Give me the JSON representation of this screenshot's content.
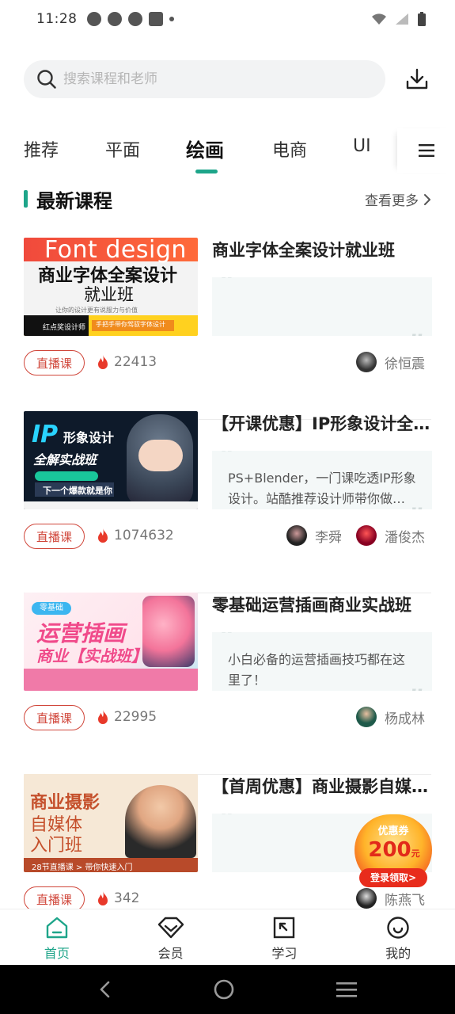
{
  "status_bar": {
    "time": "11:28"
  },
  "search": {
    "placeholder": "搜索课程和老师"
  },
  "tabs": [
    {
      "label": "推荐",
      "active": false
    },
    {
      "label": "平面",
      "active": false
    },
    {
      "label": "绘画",
      "active": true
    },
    {
      "label": "电商",
      "active": false
    },
    {
      "label": "UI",
      "active": false
    }
  ],
  "section": {
    "title": "最新课程",
    "more_label": "查看更多"
  },
  "courses": [
    {
      "title": "商业字体全案设计就业班",
      "description": "",
      "badge": "直播课",
      "views": "22413",
      "teachers": [
        "徐恒震"
      ],
      "thumb": {
        "line1": "Font design",
        "line2": "商业字体全案设计",
        "line3": "就业班",
        "line4": "让你的设计更有说服力与价值",
        "line5": "红点奖设计师",
        "line6": "手把手带你驾驭字体设计"
      }
    },
    {
      "title": "【开课优惠】IP形象设计全解实战班",
      "description": "PS+Blender，一门课吃透IP形象设计。站酷推荐设计师带你做出爆款形象",
      "badge": "直播课",
      "views": "1074632",
      "teachers": [
        "李舜",
        "潘俊杰"
      ],
      "thumb": {
        "line1": "IP",
        "line2": "形象设计",
        "line3": "全解实战班",
        "line4": "下一个爆款就是你"
      }
    },
    {
      "title": "零基础运营插画商业实战班",
      "description": "小白必备的运营插画技巧都在这里了！",
      "badge": "直播课",
      "views": "22995",
      "teachers": [
        "杨成林"
      ],
      "thumb": {
        "line1": "零基础",
        "line2": "运营插画",
        "line3": "商业【实战班】"
      }
    },
    {
      "title": "【首周优惠】商业摄影自媒体入门班",
      "description": "",
      "badge": "直播课",
      "views": "342",
      "teachers": [
        "陈燕飞"
      ],
      "thumb": {
        "line1": "商业摄影",
        "line2": "自媒体",
        "line3": "入门班",
        "line4": "28节直播课 > 带你快速入门"
      }
    }
  ],
  "coupon": {
    "title": "优惠券",
    "amount": "200",
    "unit": "元",
    "action": "登录领取>"
  },
  "bottom_nav": [
    {
      "label": "首页",
      "icon": "home-icon",
      "active": true
    },
    {
      "label": "会员",
      "icon": "diamond-icon",
      "active": false
    },
    {
      "label": "学习",
      "icon": "study-icon",
      "active": false
    },
    {
      "label": "我的",
      "icon": "profile-icon",
      "active": false
    }
  ],
  "colors": {
    "accent": "#1ea58a",
    "live_badge": "#d0463a",
    "hot_icon": "#e8392a"
  }
}
